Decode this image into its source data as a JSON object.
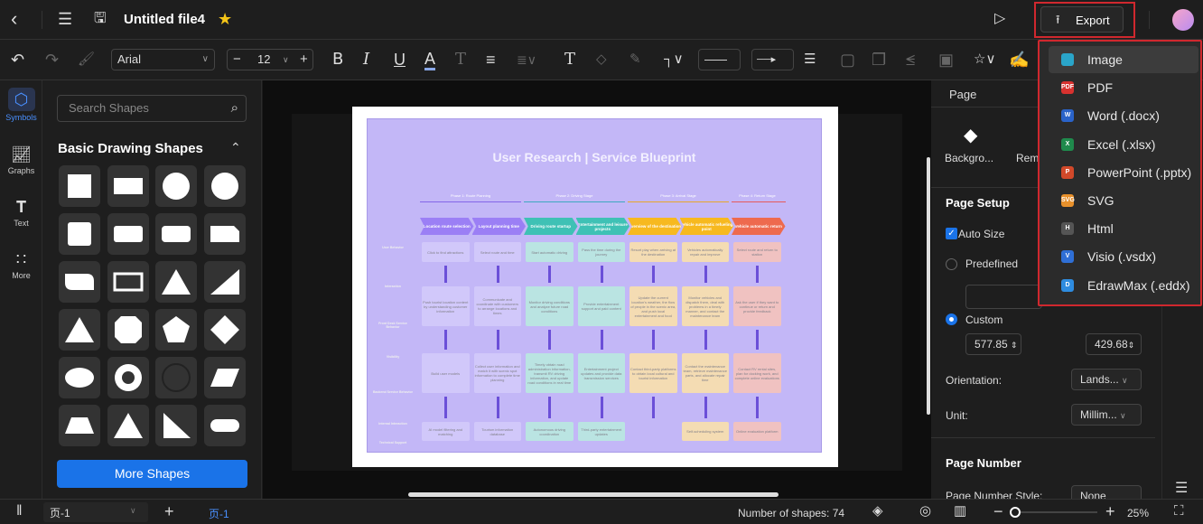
{
  "header": {
    "title": "Untitled file4",
    "export_label": "Export"
  },
  "toolbar": {
    "font": "Arial",
    "font_size": "12"
  },
  "rail": [
    {
      "label": "Symbols",
      "icon": "symbols-icon"
    },
    {
      "label": "Graphs",
      "icon": "graphs-icon"
    },
    {
      "label": "Text",
      "icon": "text-icon"
    },
    {
      "label": "More",
      "icon": "more-icon"
    }
  ],
  "shapes_panel": {
    "search_placeholder": "Search Shapes",
    "section_title": "Basic Drawing Shapes",
    "more_label": "More Shapes"
  },
  "diagram": {
    "title": "User Research | Service Blueprint",
    "phases": [
      "Phase 1: Route Planning",
      "Phase 2: Driving Stage",
      "Phase 3: Arrival Stage",
      "Phase 4: Return Stage"
    ],
    "steps": [
      "Location route selection",
      "Layout planning time",
      "Driving route startup",
      "Entertainment and leisure projects",
      "Overview of the destination",
      "Vehicle automatic refueling point",
      "Vehicle automatic return"
    ],
    "rows": [
      "User Behavior",
      "Interaction",
      "Front Desk Service Behavior",
      "Visibility",
      "Backend Service Behavior",
      "Internal Interaction",
      "Technical Support"
    ],
    "user_behavior": [
      "Click to find attractions",
      "Select route and time",
      "Start automatic driving",
      "Pass the time during the journey",
      "Resort play when arriving at the destination",
      "Vehicles automatically repair and improve",
      "Select route and return to station"
    ],
    "front_desk": [
      "Push tourist location content by understanding customer information",
      "Communicate and coordinate with customers to arrange locations and times",
      "Monitor driving conditions and analyze future road conditions",
      "Provide entertainment support and paid content",
      "Update the current location's weather, the flow of people in the scenic area, and push local entertainment and food",
      "Monitor vehicles and dispatch them, deal with problems in a timely manner, and contact the maintenance team",
      "Ask the user if they want to continue or return and provide feedback"
    ],
    "backend": [
      "Build user models",
      "Collect user information and match it with scenic spot information to complete time planning",
      "Timely obtain road administration information, transmit RV driving information, and update road conditions in real time",
      "Entertainment project updates and provide data transmission services",
      "Contact third-party platforms to obtain local cultural and tourist information",
      "Contact the maintenance team, retrieve maintenance parts, and allocate repair time",
      "Contact RV rental sites, plan for docking work, and complete online evaluations"
    ],
    "tech": [
      "AI model filtering and matching",
      "Tourism information database",
      "Autonomous driving coordination",
      "Third-party entertainment updates",
      "",
      "Self-scheduling system",
      "Online evaluation platform"
    ]
  },
  "page_panel": {
    "tab": "Page",
    "background_label": "Backgro...",
    "remove_label": "Rem",
    "page_setup": "Page Setup",
    "auto_size": "Auto Size",
    "auto_size_checked": true,
    "predefined": "Predefined",
    "custom": "Custom",
    "width": "577.85",
    "height": "429.68",
    "orientation_label": "Orientation:",
    "orientation_value": "Lands...",
    "unit_label": "Unit:",
    "unit_value": "Millim...",
    "page_number": "Page Number",
    "page_number_style_label": "Page Number Style:",
    "page_number_style_value": "None"
  },
  "export_menu": [
    {
      "label": "Image",
      "badge": "",
      "color": "#2aa5c9"
    },
    {
      "label": "PDF",
      "badge": "PDF",
      "color": "#d8322f"
    },
    {
      "label": "Word (.docx)",
      "badge": "W",
      "color": "#2a63c9"
    },
    {
      "label": "Excel (.xlsx)",
      "badge": "X",
      "color": "#1f8a4c"
    },
    {
      "label": "PowerPoint (.pptx)",
      "badge": "P",
      "color": "#d2492a"
    },
    {
      "label": "SVG",
      "badge": "SVG",
      "color": "#e8912c"
    },
    {
      "label": "Html",
      "badge": "H",
      "color": "#555555"
    },
    {
      "label": "Visio (.vsdx)",
      "badge": "V",
      "color": "#2f6fd6"
    },
    {
      "label": "EdrawMax (.eddx)",
      "badge": "D",
      "color": "#2e8ce0"
    }
  ],
  "bottom": {
    "page_select": "页-1",
    "page_tab": "页-1",
    "shape_count": "Number of shapes: 74",
    "zoom": "25%",
    "zoom_fraction": 0.25
  }
}
